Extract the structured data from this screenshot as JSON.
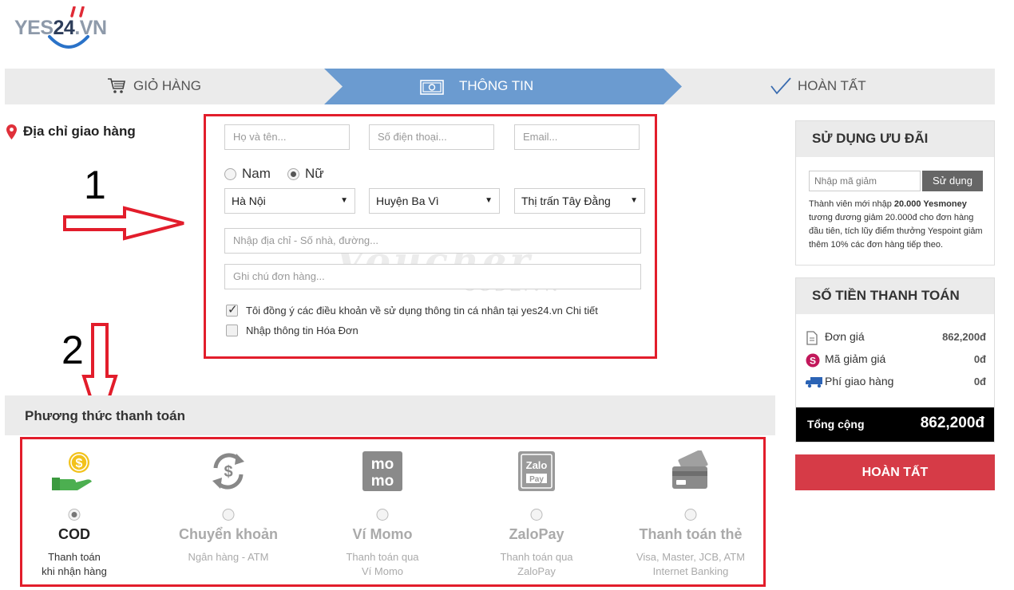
{
  "logo": {
    "text_left": "YES",
    "text_num": "24",
    "text_right": ".VN"
  },
  "steps": [
    {
      "label": "GIỎ HÀNG",
      "icon": "cart-icon",
      "active": false
    },
    {
      "label": "THÔNG TIN",
      "icon": "money-icon",
      "active": true
    },
    {
      "label": "HOÀN TẤT",
      "icon": "check-icon",
      "active": false
    }
  ],
  "colors": {
    "step_active": "#6b9bd0",
    "annotation_red": "#e21d2b",
    "finish_button": "#d63b47",
    "total_bg": "#000000"
  },
  "address": {
    "title": "Địa chỉ giao hàng",
    "icon": "location-pin-icon",
    "name_placeholder": "Họ và tên...",
    "phone_placeholder": "Số điện thoại...",
    "email_placeholder": "Email...",
    "gender_male": "Nam",
    "gender_female": "Nữ",
    "gender_selected": "Nữ",
    "province": "Hà Nội",
    "district": "Huyện Ba Vì",
    "ward": "Thị trấn Tây Đằng",
    "address_placeholder": "Nhập địa chỉ - Số nhà, đường...",
    "note_placeholder": "Ghi chú đơn hàng...",
    "terms_label": "Tôi đồng ý các điều khoản về sử dụng thông tin cá nhân tại yes24.vn",
    "terms_link": "Chi tiết",
    "terms_checked": true,
    "invoice_label": "Nhập thông tin Hóa Đơn",
    "invoice_checked": false
  },
  "annotations": {
    "n1": "1",
    "n2": "2"
  },
  "watermark": {
    "line1": "Voucher",
    "line2": "CODE.VN"
  },
  "payment": {
    "title": "Phương thức thanh toán",
    "selected": "COD",
    "methods": [
      {
        "name": "COD",
        "desc1": "Thanh toán",
        "desc2": "khi nhận hàng",
        "icon": "cash-hand-icon"
      },
      {
        "name": "Chuyển khoản",
        "desc1": "Ngân hàng - ATM",
        "desc2": "",
        "icon": "transfer-icon"
      },
      {
        "name": "Ví Momo",
        "desc1": "Thanh toán qua",
        "desc2": "Ví Momo",
        "icon": "momo-icon"
      },
      {
        "name": "ZaloPay",
        "desc1": "Thanh toán qua",
        "desc2": "ZaloPay",
        "icon": "zalopay-icon"
      },
      {
        "name": "Thanh toán thẻ",
        "desc1": "Visa, Master, JCB, ATM",
        "desc2": "Internet Banking",
        "icon": "cards-icon"
      }
    ]
  },
  "coupon": {
    "title": "SỬ DỤNG ƯU ĐÃI",
    "placeholder": "Nhập mã giảm",
    "button": "Sử dụng",
    "promo_a": "Thành viên mới nhập ",
    "promo_amount": "20.000 Yesmoney",
    "promo_b": " tương đương giảm 20.000đ cho đơn hàng đầu tiên, tích lũy điểm thưởng Yespoint giảm thêm 10% các đơn hàng tiếp theo."
  },
  "summary": {
    "title": "SỐ TIỀN THANH TOÁN",
    "unit_price_label": "Đơn giá",
    "unit_price": "862,200đ",
    "discount_label": "Mã giảm giá",
    "discount": "0đ",
    "shipping_label": "Phí giao hàng",
    "shipping": "0đ",
    "total_label": "Tổng cộng",
    "total": "862,200đ"
  },
  "finish_button": "HOÀN TẤT"
}
